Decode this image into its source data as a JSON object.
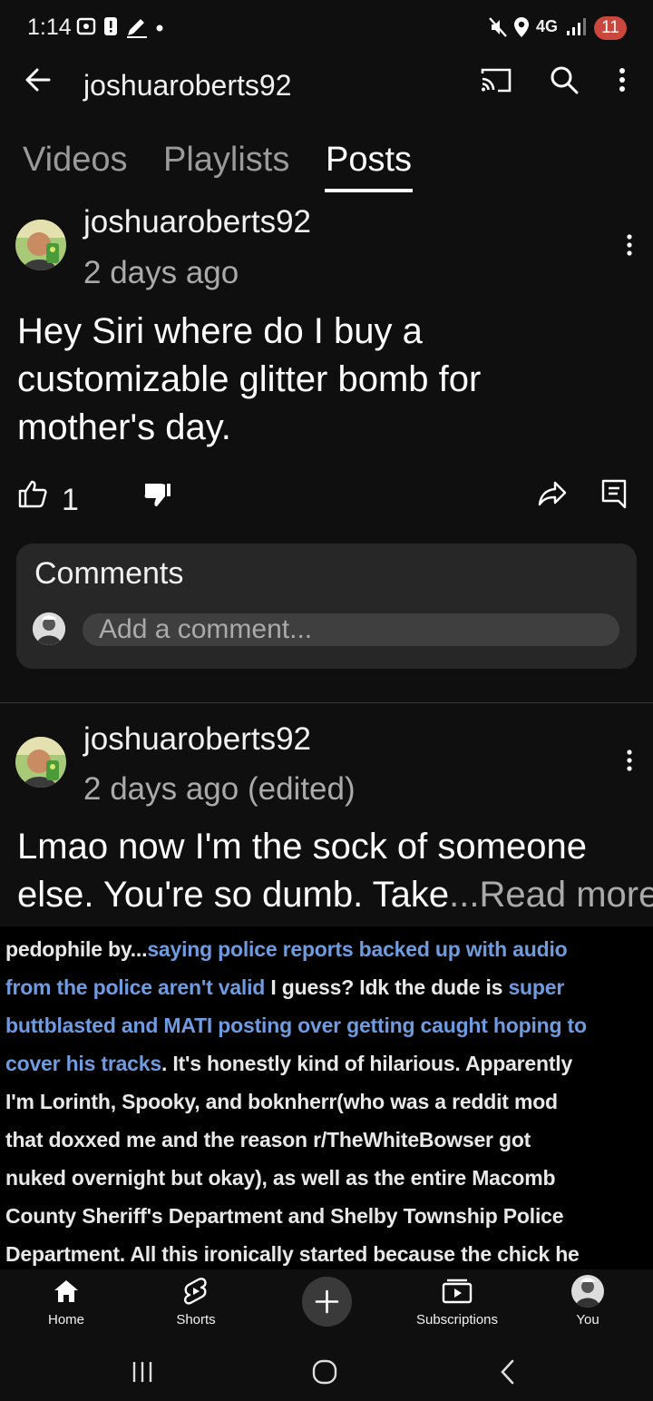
{
  "status_bar": {
    "time": "1:14",
    "network": "4G",
    "battery": "11"
  },
  "header": {
    "title": "joshuaroberts92"
  },
  "tabs": [
    {
      "label": "Videos",
      "active": false
    },
    {
      "label": "Playlists",
      "active": false
    },
    {
      "label": "Posts",
      "active": true
    }
  ],
  "posts": [
    {
      "author": "joshuaroberts92",
      "time": "2 days ago",
      "body": [
        "Hey Siri where do I buy a",
        "customizable glitter bomb for",
        "mother's day."
      ],
      "likes": "1"
    },
    {
      "author": "joshuaroberts92",
      "time": "2 days ago (edited)",
      "body": [
        "Lmao now I'm the sock of someone",
        "else.  You're so dumb.  Take"
      ],
      "ellipsis": "...",
      "read_more": "Read more"
    }
  ],
  "comments": {
    "heading": "Comments",
    "placeholder": "Add a comment..."
  },
  "image_text": {
    "l1a": "pedophile by...",
    "l1b": "saying police reports backed up with audio",
    "l2a": "from the police aren't valid",
    "l2b": " I guess? Idk the dude is ",
    "l2c": "super",
    "l3": "buttblasted and MATI posting over getting caught hoping to",
    "l4a": "cover his tracks",
    "l4b": ". It's honestly kind of hilarious. Apparently",
    "l5": "I'm Lorinth, Spooky, and boknherr(who was a reddit mod",
    "l6": "that doxxed me and the reason r/TheWhiteBowser got",
    "l7": "nuked overnight but okay), as well as the entire Macomb",
    "l8": "County Sheriff's Department and Shelby Township Police",
    "l9": "Department. All this ironically started because the chick he"
  },
  "bottom_nav": {
    "home": "Home",
    "shorts": "Shorts",
    "subscriptions": "Subscriptions",
    "you": "You"
  },
  "colors": {
    "background": "#0f0f0f",
    "card": "#272727",
    "link_highlight": "#6f9be0"
  }
}
